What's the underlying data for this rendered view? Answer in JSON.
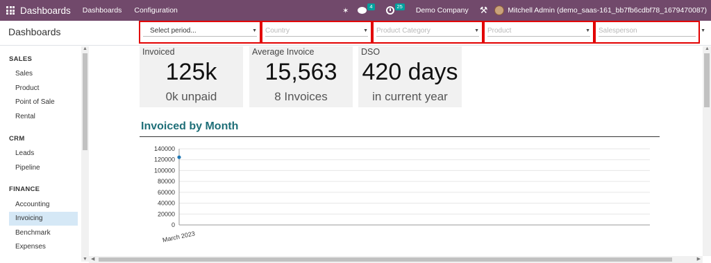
{
  "navbar": {
    "app_name": "Dashboards",
    "menu": [
      "Dashboards",
      "Configuration"
    ],
    "messages_badge": "4",
    "activities_badge": "25",
    "company": "Demo Company",
    "user": "Mitchell Admin (demo_saas-161_bb7fb6cdbf78_1679470087)",
    "icons": [
      "apps-grid-icon",
      "bug-icon",
      "chat-icon",
      "clock-icon",
      "tools-icon",
      "avatar"
    ]
  },
  "control_panel": {
    "title": "Dashboards",
    "filters": [
      {
        "label": "Select period...",
        "placeholder": false
      },
      {
        "label": "Country",
        "placeholder": true
      },
      {
        "label": "Product Category",
        "placeholder": true
      },
      {
        "label": "Product",
        "placeholder": true
      },
      {
        "label": "Salesperson",
        "placeholder": true
      }
    ],
    "highlight_color": "#e20000"
  },
  "sidebar": {
    "sections": [
      {
        "title": "SALES",
        "items": [
          "Sales",
          "Product",
          "Point of Sale",
          "Rental"
        ]
      },
      {
        "title": "CRM",
        "items": [
          "Leads",
          "Pipeline"
        ]
      },
      {
        "title": "FINANCE",
        "items": [
          "Accounting",
          "Invoicing",
          "Benchmark",
          "Expenses"
        ]
      }
    ],
    "active_item": "Invoicing"
  },
  "kpis": [
    {
      "label": "Invoiced",
      "value": "125k",
      "sub": "0k unpaid"
    },
    {
      "label": "Average Invoice",
      "value": "15,563",
      "sub": "8 Invoices"
    },
    {
      "label": "DSO",
      "value": "420 days",
      "sub": "in current year"
    }
  ],
  "section": {
    "title": "Invoiced by Month"
  },
  "chart_data": {
    "type": "line",
    "categories": [
      "March 2023"
    ],
    "series": [
      {
        "values": [
          124500
        ]
      }
    ],
    "y_ticks": [
      0,
      20000,
      40000,
      60000,
      80000,
      100000,
      120000,
      140000
    ],
    "ylim": [
      0,
      140000
    ],
    "grid": true,
    "color": "#1f77b4"
  },
  "colors": {
    "navbar": "#71496b",
    "accent_title": "#1f6f78",
    "active_item_bg": "#d5e8f6"
  }
}
